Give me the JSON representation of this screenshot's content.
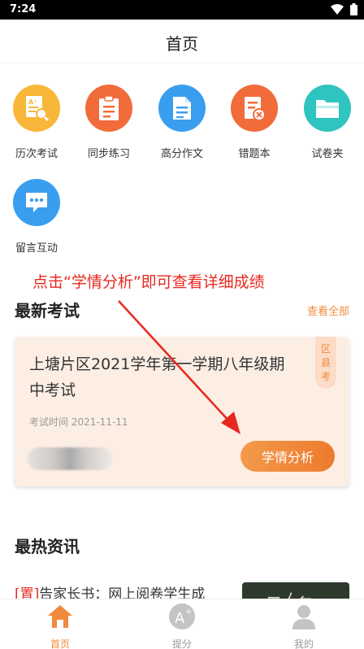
{
  "status_bar": {
    "time": "7:24"
  },
  "nav": {
    "title": "首页"
  },
  "features": [
    {
      "label": "历次考试",
      "icon": "exam-history-icon",
      "color": "#f9b739"
    },
    {
      "label": "同步练习",
      "icon": "clipboard-icon",
      "color": "#f26b3a"
    },
    {
      "label": "高分作文",
      "icon": "document-icon",
      "color": "#3a9ef0"
    },
    {
      "label": "错题本",
      "icon": "error-notebook-icon",
      "color": "#f26b3a"
    },
    {
      "label": "试卷夹",
      "icon": "folder-icon",
      "color": "#2ec4c0"
    },
    {
      "label": "留言互动",
      "icon": "chat-bubble-icon",
      "color": "#3a9ef0"
    }
  ],
  "annotation": {
    "text": "点击“学情分析”即可查看详细成绩",
    "color": "#e8271e"
  },
  "latest_exams": {
    "title": "最新考试",
    "view_all": "查看全部",
    "card": {
      "title": "上塘片区2021学年第一学期八年级期中考试",
      "time": "考试时间 2021-11-11",
      "tag_chars": [
        "区",
        "县",
        "考"
      ],
      "button": "学情分析"
    }
  },
  "hot_news": {
    "title": "最热资讯",
    "item": {
      "tag": "[置]",
      "text": "告家长书：网上阅卷学生成"
    }
  },
  "tabs": [
    {
      "label": "首页",
      "icon": "home-icon",
      "active": true
    },
    {
      "label": "提分",
      "icon": "score-up-icon",
      "active": false
    },
    {
      "label": "我的",
      "icon": "profile-icon",
      "active": false
    }
  ],
  "colors": {
    "accent": "#f08a3c",
    "card_bg": "#fdeee4"
  }
}
